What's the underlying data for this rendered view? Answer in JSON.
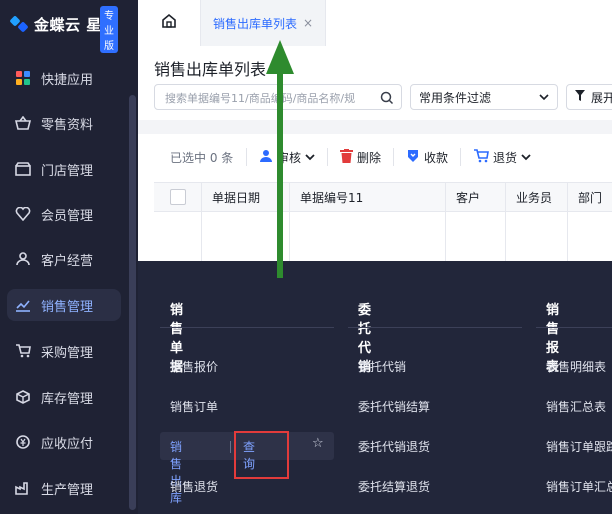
{
  "app": {
    "brand": "金蝶云 星辰",
    "edition_badge": "专业版"
  },
  "sidebar": {
    "items": [
      {
        "label": "快捷应用",
        "icon": "grid-icon"
      },
      {
        "label": "零售资料",
        "icon": "basket-icon"
      },
      {
        "label": "门店管理",
        "icon": "store-icon"
      },
      {
        "label": "会员管理",
        "icon": "heart-icon"
      },
      {
        "label": "客户经营",
        "icon": "user-icon"
      },
      {
        "label": "销售管理",
        "icon": "chart-icon",
        "active": true
      },
      {
        "label": "采购管理",
        "icon": "cart-icon"
      },
      {
        "label": "库存管理",
        "icon": "box-icon"
      },
      {
        "label": "应收应付",
        "icon": "money-icon"
      },
      {
        "label": "生产管理",
        "icon": "factory-icon"
      }
    ]
  },
  "tabs": {
    "active_label": "销售出库单列表",
    "close_glyph": "×"
  },
  "page": {
    "title": "销售出库单列表",
    "search_placeholder": "搜索单据编号11/商品编码/商品名称/规",
    "filter_select": "常用条件过滤",
    "expand_button": "展开"
  },
  "toolbar": {
    "selected": "已选中 0 条",
    "audit": "审核",
    "delete": "删除",
    "collect": "收款",
    "return": "退货"
  },
  "table": {
    "columns": [
      "",
      "单据日期",
      "单据编号11",
      "客户",
      "业务员",
      "部门"
    ]
  },
  "mega_menu": {
    "columns": [
      {
        "title": "销售单据",
        "items": [
          "销售报价",
          "销售订单",
          "销售出库",
          "销售退货"
        ]
      },
      {
        "title": "委托代销",
        "items": [
          "委托代销",
          "委托代销结算",
          "委托代销退货",
          "委托结算退货"
        ]
      },
      {
        "title": "销售报表",
        "items": [
          "销售明细表",
          "销售汇总表",
          "销售订单跟踪",
          "销售订单汇总"
        ]
      }
    ],
    "highlight": {
      "item": "销售出库",
      "sep": "|",
      "action": "查询",
      "star": "☆"
    }
  },
  "colors": {
    "sidebar_bg": "#1f2234",
    "accent": "#2c6bff",
    "menu_bg": "#22263a",
    "annotation_red": "#e23b3b",
    "annotation_green": "#2e8b2e"
  }
}
